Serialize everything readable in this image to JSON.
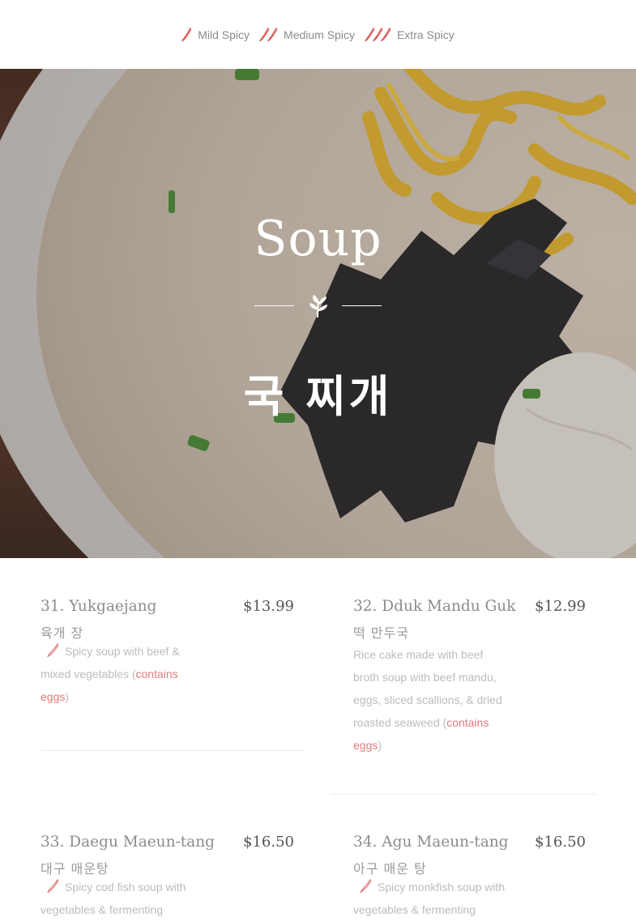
{
  "legend": {
    "items": [
      {
        "label": "Mild Spicy",
        "peppers": 1
      },
      {
        "label": "Medium Spicy",
        "peppers": 2
      },
      {
        "label": "Extra Spicy",
        "peppers": 3
      }
    ]
  },
  "hero": {
    "title": "Soup",
    "subtitle": "국 찌개"
  },
  "menu": [
    {
      "name": "31. Yukgaejang",
      "kname": "육개 장",
      "price": "$13.99",
      "spicy": true,
      "desc": "Spicy soup with beef & mixed vegetables (",
      "contains": "contains eggs",
      "close": ")"
    },
    {
      "name": "32. Dduk Mandu Guk",
      "kname": "떡 만두국",
      "price": "$12.99",
      "spicy": false,
      "desc": "Rice cake made with beef broth soup with beef mandu, eggs, sliced scallions, & dried roasted seaweed (",
      "contains": "contains eggs",
      "close": ")"
    },
    {
      "name": "33. Daegu Maeun-tang",
      "kname": "대구 매운탕",
      "price": "$16.50",
      "spicy": true,
      "desc": "Spicy cod fish soup with vegetables & fermenting",
      "contains": "",
      "close": ""
    },
    {
      "name": "34. Agu Maeun-tang",
      "kname": "아구 매운 탕",
      "price": "$16.50",
      "spicy": true,
      "desc": "Spicy monkfish soup with vegetables & fermenting",
      "contains": "",
      "close": ""
    }
  ],
  "colors": {
    "accent": "#e07b7b",
    "pepper": "#d9534f"
  }
}
